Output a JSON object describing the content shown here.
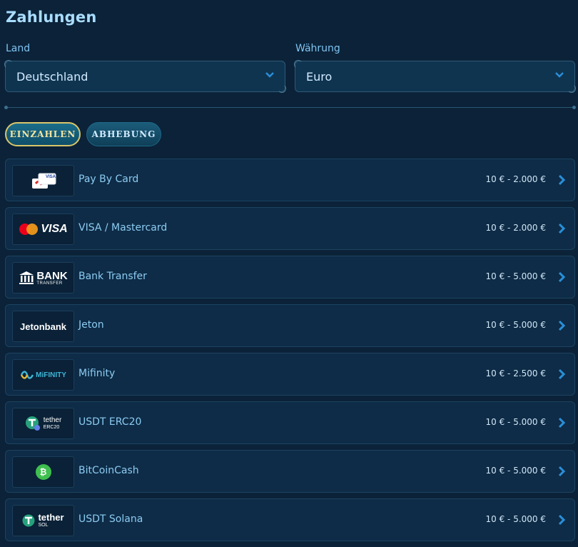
{
  "page": {
    "title": "Zahlungen"
  },
  "filters": {
    "country": {
      "label": "Land",
      "value": "Deutschland"
    },
    "currency": {
      "label": "Währung",
      "value": "Euro"
    }
  },
  "tabs": [
    {
      "label": "EINZAHLEN",
      "active": true
    },
    {
      "label": "ABHEBUNG",
      "active": false
    }
  ],
  "methods": [
    {
      "name": "Pay By Card",
      "range": "10 € - 2.000 €",
      "logo": "card-icon",
      "logo_text": "VISA"
    },
    {
      "name": "VISA / Mastercard",
      "range": "10 € - 2.000 €",
      "logo": "visa-mastercard-logo",
      "logo_text": "VISA"
    },
    {
      "name": "Bank Transfer",
      "range": "10 € - 5.000 €",
      "logo": "bank-logo",
      "logo_text": "BANK",
      "logo_sub": "TRANSFER"
    },
    {
      "name": "Jeton",
      "range": "10 € - 5.000 €",
      "logo": "jetonbank-logo",
      "logo_text": "Jetonbank"
    },
    {
      "name": "Mifinity",
      "range": "10 € - 2.500 €",
      "logo": "mifinity-logo",
      "logo_text": "MiFINITY"
    },
    {
      "name": "USDT ERC20",
      "range": "10 € - 5.000 €",
      "logo": "tether-erc20-logo",
      "logo_text": "tether",
      "logo_sub": "ERC20"
    },
    {
      "name": "BitCoinCash",
      "range": "10 € - 5.000 €",
      "logo": "bitcoincash-logo",
      "logo_text": "₿"
    },
    {
      "name": "USDT Solana",
      "range": "10 € - 5.000 €",
      "logo": "tether-sol-logo",
      "logo_text": "tether",
      "logo_sub": "SOL"
    }
  ],
  "colors": {
    "background": "#0b2238",
    "accent": "#2a8fd8",
    "tab_active_border": "#d9c56a"
  }
}
